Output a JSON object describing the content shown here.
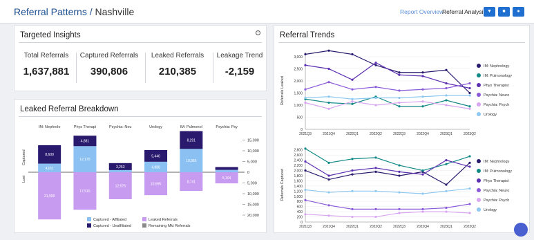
{
  "header": {
    "title": "Referral Patterns",
    "location": "Nashville",
    "nav_report": "Report Overview",
    "nav_analysis": "Referral Analysis"
  },
  "insights": {
    "title": "Targeted Insights",
    "kpis": [
      {
        "label": "Total Referrals",
        "value": "1,637,881"
      },
      {
        "label": "Captured Referrals",
        "value": "390,806"
      },
      {
        "label": "Leaked Referrals",
        "value": "210,385"
      },
      {
        "label": "Leakage Trend",
        "value": "-2,159"
      }
    ]
  },
  "colors": {
    "captured_affiliated": "#8bc1f2",
    "captured_unaffiliated": "#2a1a6e",
    "leaked": "#c79bf0",
    "remaining": "#8a8a8a",
    "accent": "#1f6fd1"
  },
  "breakdown": {
    "title": "Leaked Referral Breakdown",
    "captured_axis_label": "Captured",
    "lost_axis_label": "Lost",
    "legend": [
      "Captured - Affiliated",
      "Captured - Unaffiliated",
      "Leaked Referrals",
      "Remaining Mkt Referrals"
    ],
    "chart_data": {
      "type": "bar",
      "categories": [
        "IM: Nephrolo",
        "Phys Therapi",
        "Psychia: Neu",
        "Urology",
        "IM: Pulmonol",
        "Psychia: Psy"
      ],
      "series": [
        {
          "name": "Captured - Affiliated",
          "values": [
            4011,
            12170,
            1000,
            4888,
            10885,
            1100
          ]
        },
        {
          "name": "Captured - Unaffiliated",
          "values": [
            8600,
            4881,
            3253,
            5440,
            8291,
            1300
          ]
        },
        {
          "name": "Leaked Referrals",
          "values": [
            21999,
            17515,
            12576,
            10695,
            8741,
            5194
          ]
        }
      ],
      "value_labels": [
        {
          "affiliated": "4,011",
          "unaffiliated": "8,600",
          "leaked": "21,999"
        },
        {
          "affiliated": "12,170",
          "unaffiliated": "4,881",
          "leaked": "17,515"
        },
        {
          "affiliated": "",
          "unaffiliated": "3,253",
          "leaked": "12,576"
        },
        {
          "affiliated": "4,888",
          "unaffiliated": "5,440",
          "leaked": "10,695"
        },
        {
          "affiliated": "10,885",
          "unaffiliated": "8,291",
          "leaked": "8,741"
        },
        {
          "affiliated": "",
          "unaffiliated": "",
          "leaked": "5,194"
        }
      ],
      "yticks": [
        15000,
        10000,
        5000,
        0,
        5000,
        10000,
        15000,
        20000
      ],
      "ytick_labels": [
        "15,000",
        "10,000",
        "5,000",
        "0",
        "5,000",
        "10,000",
        "15,000",
        "20,000"
      ],
      "ylim": [
        -20000,
        15000
      ]
    }
  },
  "trends": {
    "title": "Referral Trends",
    "categories": [
      "2021Q3",
      "2021Q4",
      "2022Q1",
      "2022Q2",
      "2022Q3",
      "2022Q4",
      "2023Q1",
      "2023Q2"
    ],
    "series_names": [
      "IM: Nephrology",
      "IM: Pulmonology",
      "Phys Therapist",
      "Psychia: Neuro",
      "Psychia: Psych",
      "Urology"
    ],
    "series_colors": [
      "#2a1a6e",
      "#128a86",
      "#5b2fb0",
      "#8a5ad9",
      "#d8a6f0",
      "#8ec8f0"
    ],
    "leaked": {
      "ylabel": "Referrals Leaked",
      "ytick_labels": [
        "0",
        "500",
        "1,000",
        "1,500",
        "2,000",
        "2,500",
        "3,000"
      ],
      "chart_data": {
        "type": "line",
        "ylim": [
          0,
          3200
        ],
        "series": [
          {
            "name": "IM: Nephrology",
            "values": [
              3100,
              3250,
              3100,
              2650,
              2350,
              2350,
              2450,
              1500
            ]
          },
          {
            "name": "IM: Pulmonology",
            "values": [
              1250,
              1100,
              1050,
              1350,
              950,
              950,
              1200,
              950
            ]
          },
          {
            "name": "Phys Therapist",
            "values": [
              2650,
              2500,
              2050,
              2750,
              2250,
              2200,
              1900,
              1700
            ]
          },
          {
            "name": "Psychia: Neuro",
            "values": [
              1650,
              1950,
              1650,
              1750,
              1600,
              1650,
              1700,
              1900
            ]
          },
          {
            "name": "Psychia: Psych",
            "values": [
              1100,
              850,
              1150,
              1000,
              1100,
              1150,
              1000,
              850
            ]
          },
          {
            "name": "Urology",
            "values": [
              1300,
              1350,
              1250,
              1300,
              1300,
              1350,
              1400,
              1400
            ]
          }
        ]
      }
    },
    "captured": {
      "ylabel": "Referrals Captured",
      "ytick_labels": [
        "0",
        "200",
        "400",
        "600",
        "800",
        "1,000",
        "1,200",
        "1,400",
        "1,600",
        "1,800",
        "2,000",
        "2,200",
        "2,400",
        "2,600",
        "2,800"
      ],
      "chart_data": {
        "type": "line",
        "ylim": [
          0,
          2900
        ],
        "series": [
          {
            "name": "IM: Nephrology",
            "values": [
              2000,
              1650,
              1850,
              1950,
              1800,
              1950,
              1450,
              2300
            ]
          },
          {
            "name": "IM: Pulmonology",
            "values": [
              2850,
              2300,
              2450,
              2500,
              2200,
              2000,
              2250,
              2550
            ]
          },
          {
            "name": "Phys Therapist",
            "values": [
              2350,
              1800,
              2000,
              2100,
              1950,
              1850,
              2400,
              2150
            ]
          },
          {
            "name": "Psychia: Neuro",
            "values": [
              850,
              650,
              500,
              500,
              500,
              500,
              550,
              700
            ]
          },
          {
            "name": "Psychia: Psych",
            "values": [
              300,
              250,
              200,
              200,
              350,
              400,
              400,
              350
            ]
          },
          {
            "name": "Urology",
            "values": [
              1250,
              1150,
              1200,
              1200,
              1150,
              1100,
              1200,
              1300
            ]
          }
        ]
      }
    }
  }
}
